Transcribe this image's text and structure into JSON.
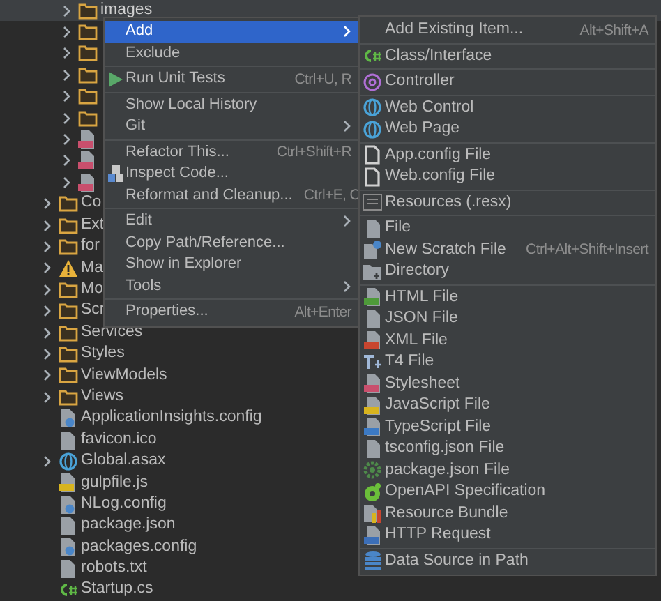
{
  "tree": {
    "items": [
      {
        "children": [
          {
            "name": "images",
            "kind": "folder",
            "expanded": false,
            "selected": true
          },
          {
            "kind": "folder",
            "expanded": false,
            "selected": false
          },
          {
            "kind": "folder",
            "expanded": false,
            "selected": false
          },
          {
            "kind": "folder",
            "expanded": false,
            "selected": false
          },
          {
            "kind": "folder",
            "expanded": false,
            "selected": false
          },
          {
            "kind": "folder",
            "expanded": false,
            "selected": false
          },
          {
            "kind": "css",
            "expanded": false,
            "selected": false
          },
          {
            "kind": "css",
            "expanded": false,
            "selected": false
          },
          {
            "kind": "css",
            "expanded": false,
            "selected": false
          }
        ]
      },
      {
        "name": "Co",
        "kind": "folder",
        "expanded": false,
        "selected": false
      },
      {
        "name": "Ext",
        "kind": "folder",
        "expanded": false,
        "selected": false
      },
      {
        "name": "for",
        "kind": "folder",
        "expanded": false,
        "selected": false
      },
      {
        "name": "Ma",
        "kind": "warning",
        "expanded": false,
        "selected": false
      },
      {
        "name": "Mo",
        "kind": "folder",
        "expanded": false,
        "selected": false
      },
      {
        "name": "Scr",
        "kind": "folder",
        "expanded": false,
        "selected": false
      },
      {
        "name": "Services",
        "kind": "folder",
        "expanded": false,
        "selected": false
      },
      {
        "name": "Styles",
        "kind": "folder",
        "expanded": false,
        "selected": false
      },
      {
        "name": "ViewModels",
        "kind": "folder",
        "expanded": false,
        "selected": false
      },
      {
        "name": "Views",
        "kind": "folder",
        "expanded": false,
        "selected": false
      },
      {
        "name": "ApplicationInsights.config",
        "kind": "config",
        "selected": false
      },
      {
        "name": "favicon.ico",
        "kind": "file",
        "selected": false
      },
      {
        "name": "Global.asax",
        "kind": "web",
        "expanded": false,
        "selected": false
      },
      {
        "name": "gulpfile.js",
        "kind": "js",
        "selected": false
      },
      {
        "name": "NLog.config",
        "kind": "config",
        "selected": false
      },
      {
        "name": "package.json",
        "kind": "json",
        "selected": false
      },
      {
        "name": "packages.config",
        "kind": "config",
        "selected": false
      },
      {
        "name": "robots.txt",
        "kind": "file",
        "selected": false
      },
      {
        "name": "Startup.cs",
        "kind": "csharp",
        "selected": false
      }
    ]
  },
  "context_menu": {
    "items": [
      {
        "kind": "text",
        "label": "Add",
        "submenu": true,
        "selected": true
      },
      {
        "kind": "text",
        "label": "Exclude",
        "selected": false
      },
      {
        "kind": "separator"
      },
      {
        "kind": "play",
        "label": "Run Unit Tests",
        "shortcut": "Ctrl+U, R",
        "selected": false
      },
      {
        "kind": "separator"
      },
      {
        "kind": "text",
        "label": "Show Local History",
        "selected": false
      },
      {
        "kind": "text",
        "label": "Git",
        "submenu": true,
        "selected": false
      },
      {
        "kind": "separator"
      },
      {
        "kind": "text",
        "label": "Refactor This...",
        "shortcut": "Ctrl+Shift+R",
        "selected": false
      },
      {
        "kind": "inspect",
        "label": "Inspect Code...",
        "selected": false
      },
      {
        "kind": "text",
        "label": "Reformat and Cleanup...",
        "shortcut": "Ctrl+E, C",
        "selected": false
      },
      {
        "kind": "separator"
      },
      {
        "kind": "text",
        "label": "Edit",
        "submenu": true,
        "selected": false
      },
      {
        "kind": "text",
        "label": "Copy Path/Reference...",
        "selected": false
      },
      {
        "kind": "text",
        "label": "Show in Explorer",
        "selected": false
      },
      {
        "kind": "text",
        "label": "Tools",
        "submenu": true,
        "selected": false
      },
      {
        "kind": "separator"
      },
      {
        "kind": "text",
        "label": "Properties...",
        "shortcut": "Alt+Enter",
        "selected": false
      }
    ]
  },
  "add_submenu": {
    "items": [
      {
        "kind": "text",
        "label": "Add Existing Item...",
        "shortcut": "Alt+Shift+A"
      },
      {
        "kind": "separator"
      },
      {
        "kind": "csharp",
        "label": "Class/Interface"
      },
      {
        "kind": "separator"
      },
      {
        "kind": "at",
        "label": "Controller"
      },
      {
        "kind": "separator"
      },
      {
        "kind": "web",
        "label": "Web Control"
      },
      {
        "kind": "web",
        "label": "Web Page"
      },
      {
        "kind": "separator"
      },
      {
        "kind": "plain",
        "label": "App.config File"
      },
      {
        "kind": "plain",
        "label": "Web.config File"
      },
      {
        "kind": "separator"
      },
      {
        "kind": "resx",
        "label": "Resources (.resx)"
      },
      {
        "kind": "separator"
      },
      {
        "kind": "file",
        "label": "File"
      },
      {
        "kind": "scratch",
        "label": "New Scratch File",
        "shortcut": "Ctrl+Alt+Shift+Insert"
      },
      {
        "kind": "directory",
        "label": "Directory"
      },
      {
        "kind": "separator"
      },
      {
        "kind": "html",
        "label": "HTML File"
      },
      {
        "kind": "json",
        "label": "JSON File"
      },
      {
        "kind": "xml",
        "label": "XML File"
      },
      {
        "kind": "t4",
        "label": "T4 File"
      },
      {
        "kind": "css",
        "label": "Stylesheet"
      },
      {
        "kind": "js",
        "label": "JavaScript File"
      },
      {
        "kind": "ts",
        "label": "TypeScript File"
      },
      {
        "kind": "json",
        "label": "tsconfig.json File"
      },
      {
        "kind": "npm",
        "label": "package.json File"
      },
      {
        "kind": "openapi",
        "label": "OpenAPI Specification"
      },
      {
        "kind": "bundle",
        "label": "Resource Bundle"
      },
      {
        "kind": "http",
        "label": "HTTP Request"
      },
      {
        "kind": "separator"
      },
      {
        "kind": "database",
        "label": "Data Source in Path"
      }
    ]
  }
}
